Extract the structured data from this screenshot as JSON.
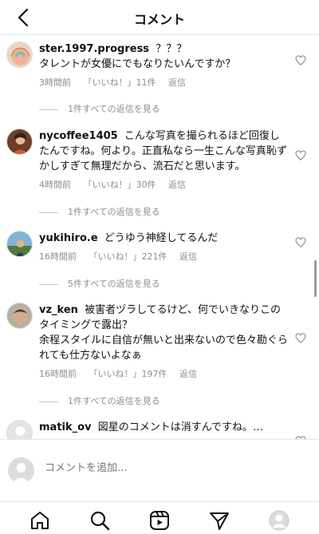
{
  "header": {
    "title": "コメント"
  },
  "comments": [
    {
      "username": "ster.1997.progress",
      "text": "？？？\nタレントが女優にでもなりたいんですか？",
      "time": "3時間前",
      "likes": "「いいね！」11件",
      "reply": "返信",
      "view_replies": "1件すべての返信を見る"
    },
    {
      "username": "nycoffee1405",
      "text": "こんな写真を撮られるほど回復したんですね。何より。正直私なら一生こんな写真恥ずかしすぎて無理だから、流石だと思います。",
      "time": "4時間前",
      "likes": "「いいね！」30件",
      "reply": "返信",
      "view_replies": "1件すべての返信を見る"
    },
    {
      "username": "yukihiro.e",
      "text": "どうゆう神経してるんだ",
      "time": "16時間前",
      "likes": "「いいね！」221件",
      "reply": "返信",
      "view_replies": "5件すべての返信を見る"
    },
    {
      "username": "vz_ken",
      "text": "被害者ヅラしてるけど、何でいきなりこのタイミングで露出？\n余程スタイルに自信が無いと出来ないので色々勘ぐられても仕方ないよなぁ",
      "time": "16時間前",
      "likes": "「いいね！」197件",
      "reply": "返信",
      "view_replies": "1件すべての返信を見る"
    },
    {
      "username": "matik_ov",
      "text": "図星のコメントは消すんですね。…",
      "time": "",
      "likes": "",
      "reply": "",
      "view_replies": ""
    }
  ],
  "composer": {
    "placeholder": "コメントを追加..."
  },
  "tabs": [
    "home-icon",
    "search-icon",
    "reels-icon",
    "direct-icon",
    "profile-icon"
  ],
  "colors": {
    "muted": "#8e8e8e",
    "divider": "#e6e6e6"
  }
}
